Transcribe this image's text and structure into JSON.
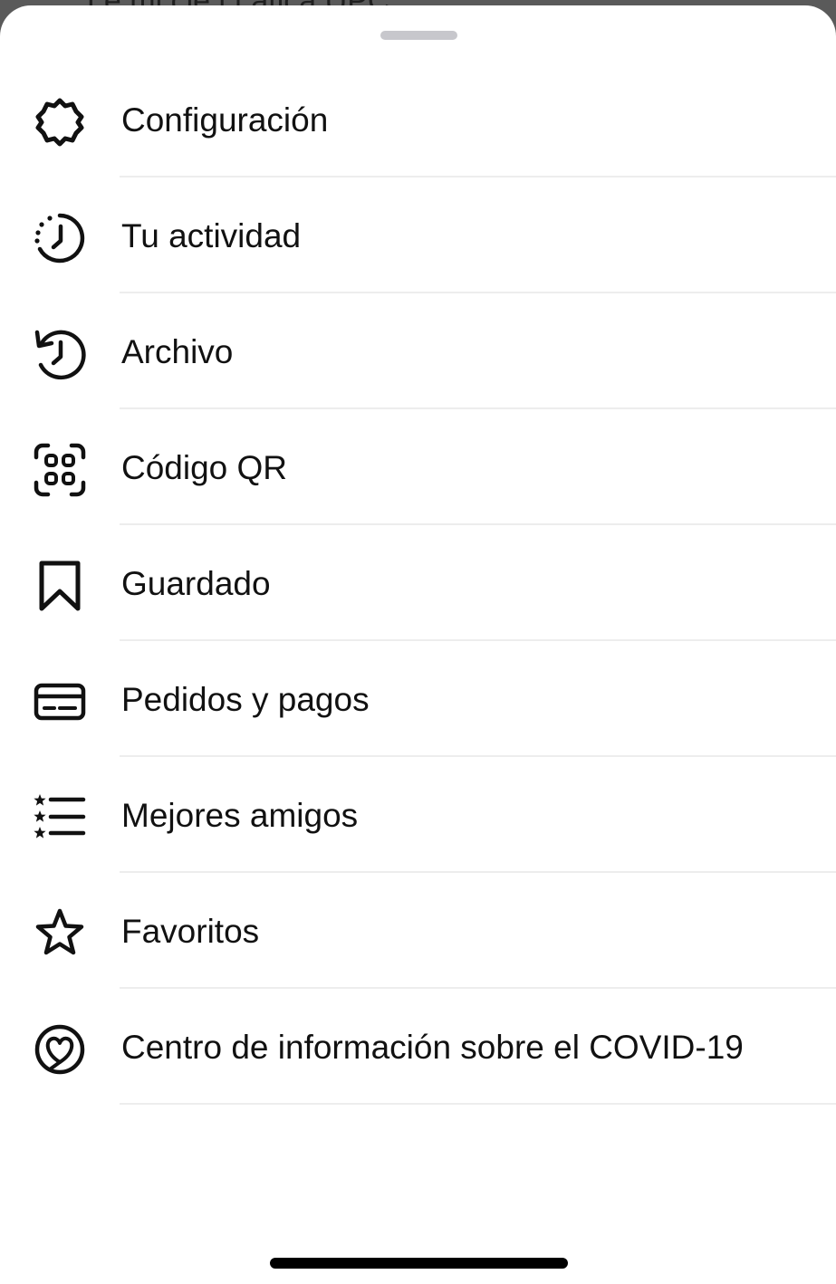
{
  "backdrop": {
    "partial_text": "Le  mi cié  i f     ática  UPC"
  },
  "menu": {
    "items": [
      {
        "label": "Configuración",
        "icon": "gear-icon"
      },
      {
        "label": "Tu actividad",
        "icon": "activity-icon"
      },
      {
        "label": "Archivo",
        "icon": "archive-icon"
      },
      {
        "label": "Código QR",
        "icon": "qr-code-icon"
      },
      {
        "label": "Guardado",
        "icon": "bookmark-icon"
      },
      {
        "label": "Pedidos y pagos",
        "icon": "credit-card-icon"
      },
      {
        "label": "Mejores amigos",
        "icon": "close-friends-list-icon"
      },
      {
        "label": "Favoritos",
        "icon": "star-icon"
      },
      {
        "label": "Centro de información sobre el COVID-19",
        "icon": "covid-heart-icon"
      }
    ]
  },
  "colors": {
    "sheet_background": "#ffffff",
    "text": "#111111",
    "divider": "#ededed",
    "grabber": "#c7c7cc",
    "home_indicator": "#000000"
  }
}
